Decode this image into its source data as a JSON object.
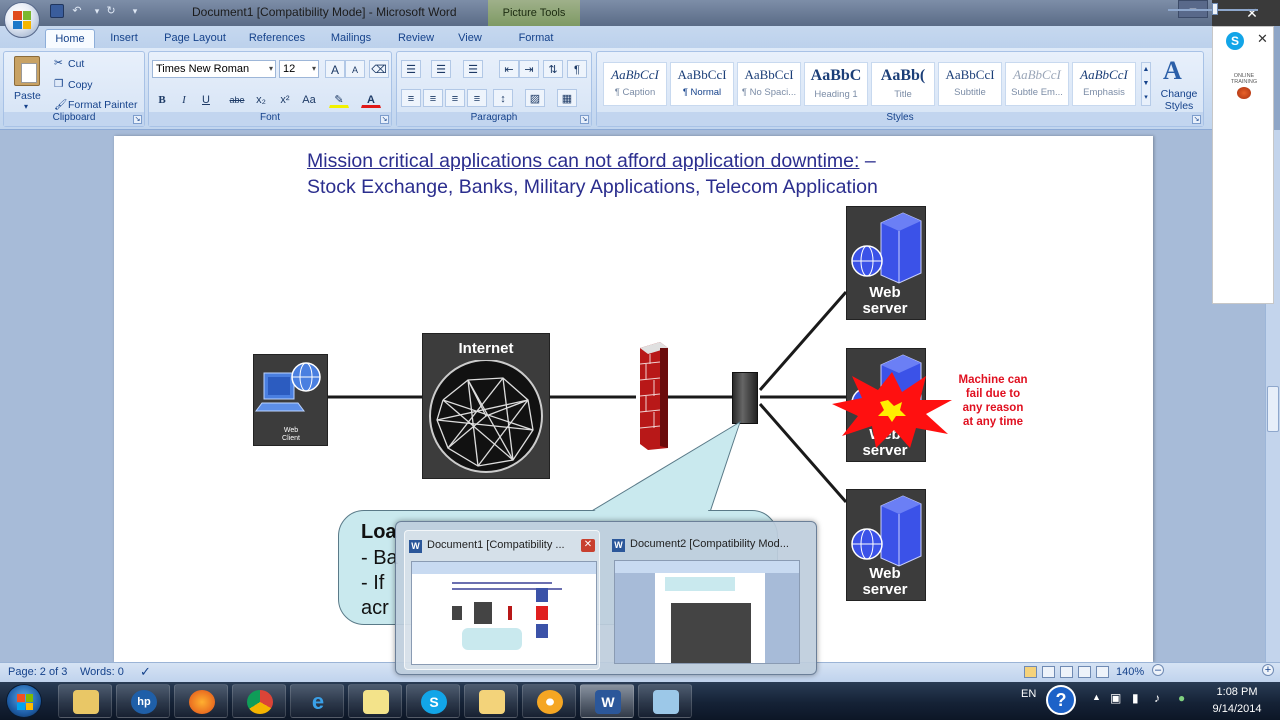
{
  "window": {
    "title": "Document1 [Compatibility Mode] - Microsoft Word",
    "contextual_tab": "Picture Tools"
  },
  "tabs": [
    {
      "label": "Home",
      "active": true
    },
    {
      "label": "Insert"
    },
    {
      "label": "Page Layout"
    },
    {
      "label": "References"
    },
    {
      "label": "Mailings"
    },
    {
      "label": "Review"
    },
    {
      "label": "View"
    },
    {
      "label": "Format"
    }
  ],
  "ribbon": {
    "clipboard": {
      "paste": "Paste",
      "cut": "Cut",
      "copy": "Copy",
      "format_painter": "Format Painter",
      "label": "Clipboard"
    },
    "font": {
      "name": "Times New Roman",
      "size": "12",
      "label": "Font",
      "bold": "B",
      "italic": "I",
      "underline": "U",
      "strikethrough": "abe",
      "subscript": "x₂",
      "superscript": "x²",
      "change_case": "Aa",
      "grow": "A",
      "shrink": "A"
    },
    "paragraph": {
      "label": "Paragraph",
      "show_hide": "¶"
    },
    "styles": {
      "label": "Styles",
      "change_styles": "Change Styles",
      "items": [
        {
          "sample": "AaBbCcI",
          "name": "¶ Caption"
        },
        {
          "sample": "AaBbCcI",
          "name": "¶ Normal",
          "selected": true
        },
        {
          "sample": "AaBbCcI",
          "name": "¶ No Spaci..."
        },
        {
          "sample": "AaBbC",
          "name": "Heading 1"
        },
        {
          "sample": "AaBb(",
          "name": "Title"
        },
        {
          "sample": "AaBbCcI",
          "name": "Subtitle"
        },
        {
          "sample": "AaBbCcI",
          "name": "Subtle Em..."
        },
        {
          "sample": "AaBbCcI",
          "name": "Emphasis"
        }
      ]
    }
  },
  "slide": {
    "heading_underlined": "Mission critical applications can not afford application downtime:",
    "heading_dash": " –",
    "heading_line2": "Stock Exchange, Banks, Military Applications, Telecom Application",
    "internet_label": "Internet",
    "web_client_label": "Web Client",
    "web_server_label_1": "Web server",
    "web_server_label_2": "Web server",
    "web_server_label_3": "Web server",
    "failure_note": "Machine can fail due to any reason at any time",
    "callout_line1": "Loa",
    "callout_line2": "- Ba",
    "callout_line3": "- If",
    "callout_line4": "acr"
  },
  "preview": {
    "doc1_title": "Document1 [Compatibility ...",
    "doc2_title": "Document2 [Compatibility Mod..."
  },
  "statusbar": {
    "page": "Page: 2 of 3",
    "words": "Words: 0",
    "zoom": "140%"
  },
  "skype": {
    "online_training": "ONLINE TRAINING"
  },
  "taskbar": {
    "lang": "EN",
    "time": "1:08 PM",
    "date": "9/14/2014"
  }
}
